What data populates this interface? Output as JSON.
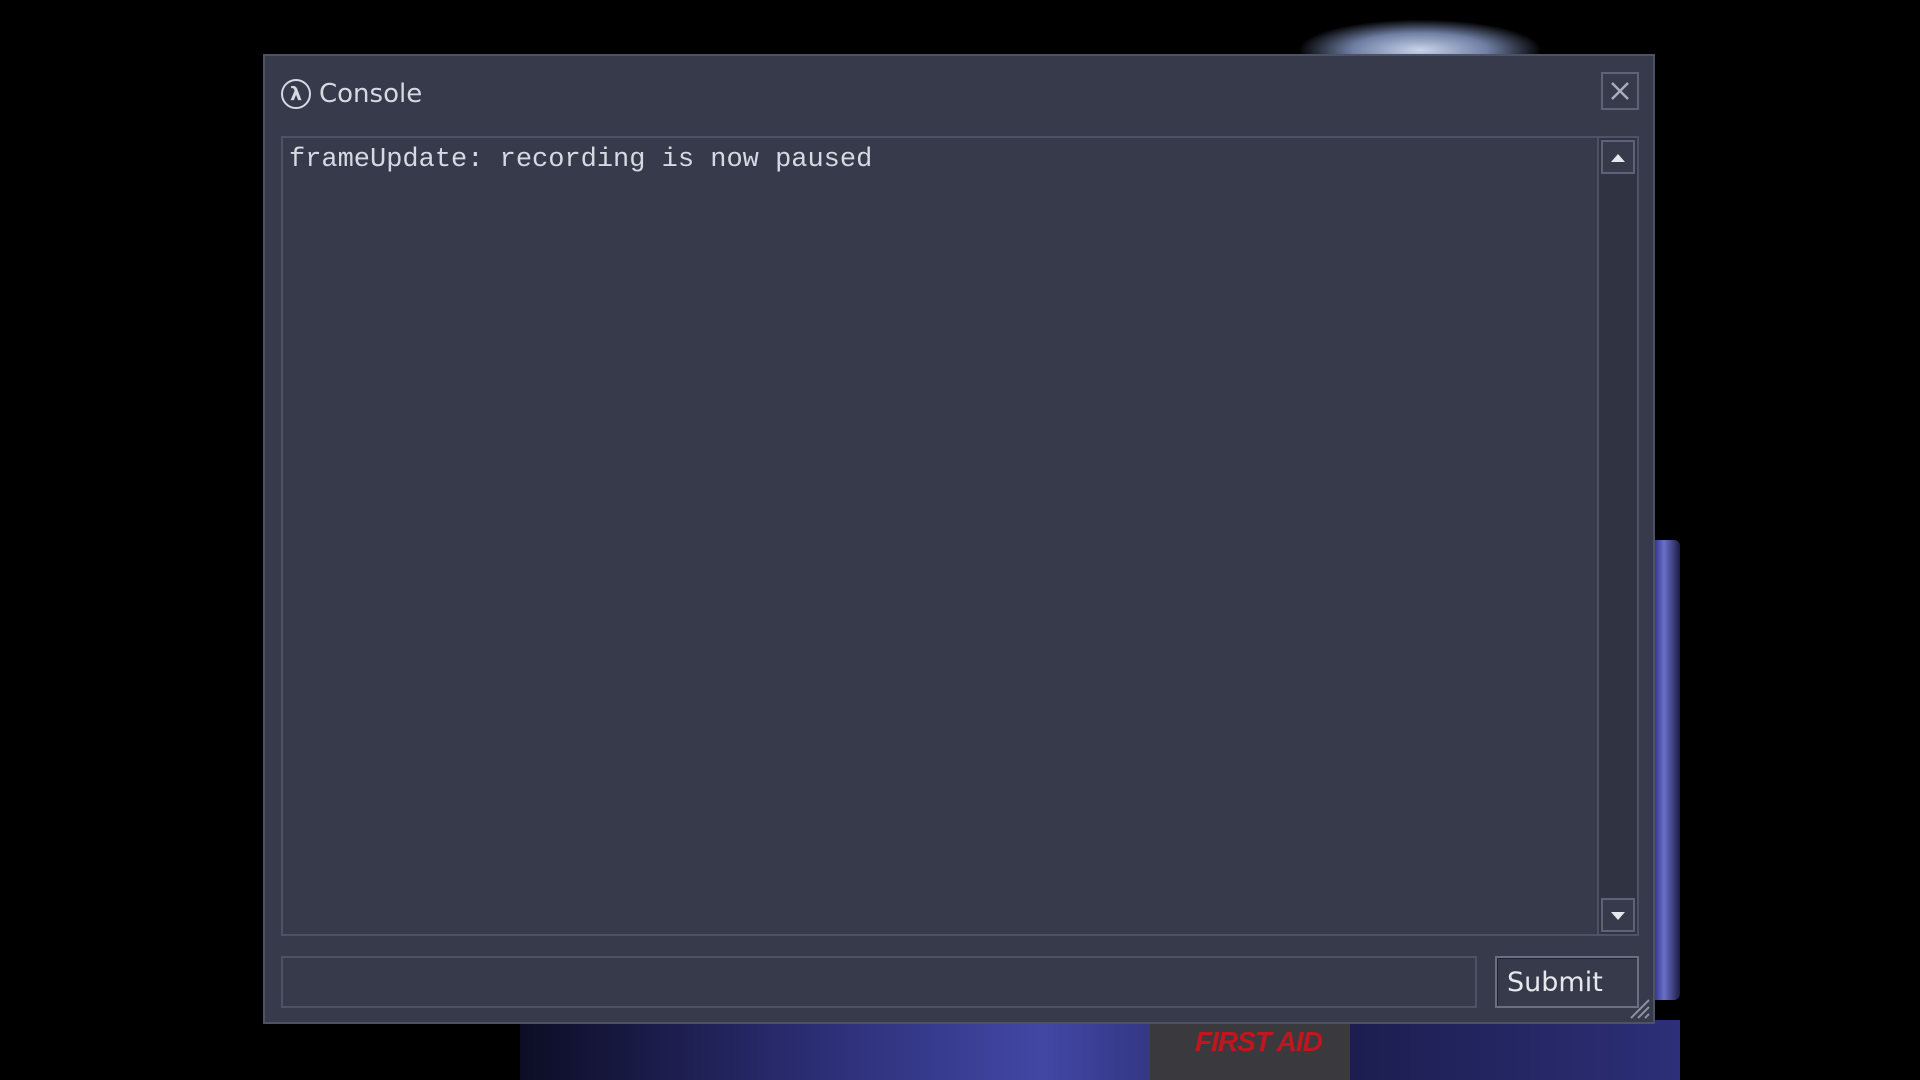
{
  "background": {
    "sign_text": "FIRST AID"
  },
  "console": {
    "title": "Console",
    "icon": "lambda-icon",
    "close_icon": "close-icon",
    "output_lines": [
      "frameUpdate: recording is now paused"
    ],
    "input": {
      "value": "",
      "placeholder": ""
    },
    "submit_label": "Submit"
  },
  "colors": {
    "window_bg": "#363a4a",
    "border": "#4e5266",
    "text": "#d6d9e2",
    "sign_red": "#c0161d"
  }
}
